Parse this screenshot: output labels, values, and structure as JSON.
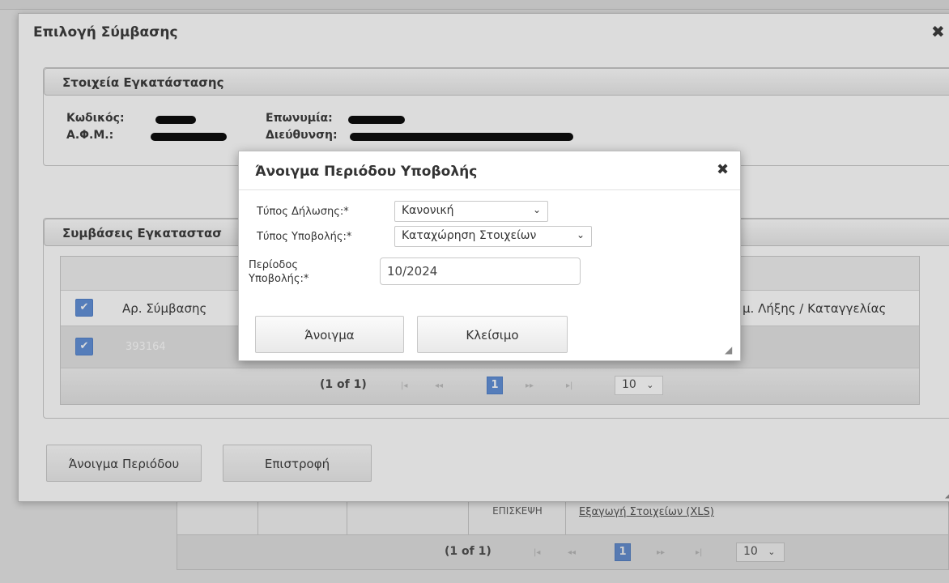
{
  "background": {
    "cell_text": "ΙΑΤΡΙΚΗ\nΕΠΙΣΚΕΨΗ",
    "export_link": "Εξαγωγή Στοιχείων (XLS)",
    "pager_text": "(1 of 1)",
    "page_number": "1",
    "page_size": "10"
  },
  "dialog": {
    "title": "Επιλογή Σύμβασης",
    "close_icon": "✖",
    "installation_section": {
      "legend": "Στοιχεία Εγκατάστασης",
      "code_label": "Κωδικός:",
      "afm_label": "Α.Φ.Μ.:",
      "name_label": "Επωνυμία:",
      "address_label": "Διεύθυνση:"
    },
    "contracts_section": {
      "legend": "Συμβάσεις Εγκαταστασ",
      "column_contract_no": "Αρ. Σύμβασης",
      "column_expiry": "μ. Λήξης / Καταγγελίας",
      "row_contract_no": "393164",
      "pager_text": "(1 of 1)",
      "page_number": "1",
      "page_size": "10"
    },
    "open_period_button": "Άνοιγμα Περιόδου",
    "return_button": "Επιστροφή"
  },
  "modal": {
    "title": "Άνοιγμα Περιόδου Υποβολής",
    "close_icon": "✖",
    "declaration_type_label": "Τύπος Δήλωσης:*",
    "declaration_type_value": "Κανονική",
    "submission_type_label": "Τύπος Υποβολής:*",
    "submission_type_value": "Καταχώρηση Στοιχείων",
    "period_label_line1": "Περίοδος",
    "period_label_line2": "Υποβολής:*",
    "period_value": "10/2024",
    "open_button": "Άνοιγμα",
    "close_button": "Κλείσιμο"
  },
  "icons": {
    "caret": "⌄",
    "checkmark": "✔",
    "first": "|◂",
    "prev": "◂◂",
    "next": "▸▸",
    "last": "▸|",
    "resize_grip": "◢"
  },
  "colors": {
    "accent": "#5b8bd6",
    "row_selected": "#e3e3e3",
    "redaction": "#000000"
  }
}
